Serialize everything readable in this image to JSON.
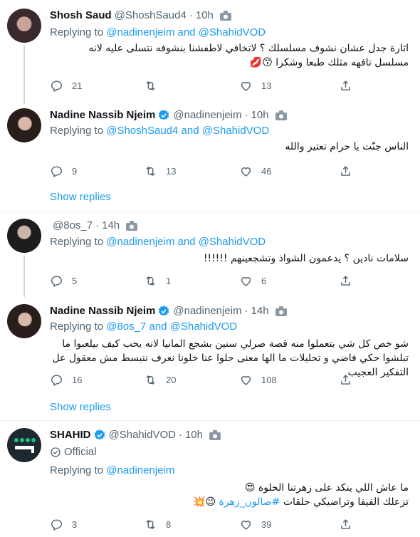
{
  "colors": {
    "link": "#1d9bf0",
    "muted": "#536471",
    "text": "#0f1419",
    "verified": "#1d9bf0"
  },
  "tweets": [
    {
      "name": "Shosh Saud",
      "handle": "@ShoshSaud4",
      "time": "10h",
      "replying_prefix": "Replying to",
      "replying_link": "@nadinenjeim and @ShahidVOD",
      "text": "اثارة جدل عشان نشوف مسلسلك ؟ لاتخافي لاطفشنا بنشوفه نتسلى عليه لانه مسلسل تافهه مثلك طبعا وشكرا 😙💋",
      "replies": "21",
      "retweets": "",
      "likes": "13"
    },
    {
      "name": "Nadine Nassib Njeim",
      "handle": "@nadinenjeim",
      "time": "10h",
      "replying_prefix": "Replying to",
      "replying_link": "@ShoshSaud4 and @ShahidVOD",
      "text": "الناس جنّت يا حرام تعتير والله",
      "replies": "9",
      "retweets": "13",
      "likes": "46",
      "show_replies": "Show replies"
    },
    {
      "name": "",
      "handle": "@8os_7",
      "time": "14h",
      "replying_prefix": "Replying to",
      "replying_link": "@nadinenjeim and @ShahidVOD",
      "text": "سلامات نادين ؟ يدعمون الشواذ وتشجعينهم !!!!!!",
      "replies": "5",
      "retweets": "1",
      "likes": "6"
    },
    {
      "name": "Nadine Nassib Njeim",
      "handle": "@nadinenjeim",
      "time": "14h",
      "replying_prefix": "Replying to",
      "replying_link": "@8os_7 and @ShahidVOD",
      "text": "شو خص كل شي بتعملوا منه قصة صرلي سنين بشجع المانيا لانه بحب كيف بيلعبوا ما تبلشوا حكي فاضي و تحليلات ما الها معنى حلوا عنا خلونا نعرف ننبسط مش معقول عل التفكير العجيب",
      "replies": "16",
      "retweets": "20",
      "likes": "108",
      "show_replies": "Show replies"
    },
    {
      "name": "SHAHID",
      "handle": "@ShahidVOD",
      "time": "10h",
      "official": "Official",
      "replying_prefix": "Replying to",
      "replying_link": "@nadinenjeim",
      "text_line1": "ما عاش اللي ينكد على زهرتنا الحلوة 😍",
      "text_line2_pre": "تزعلك الفيفا وتراضيكي حلقات ",
      "text_line2_hash": "#صالون_زهرة",
      "text_line2_post": " 😉💥",
      "replies": "3",
      "retweets": "8",
      "likes": "39"
    }
  ]
}
